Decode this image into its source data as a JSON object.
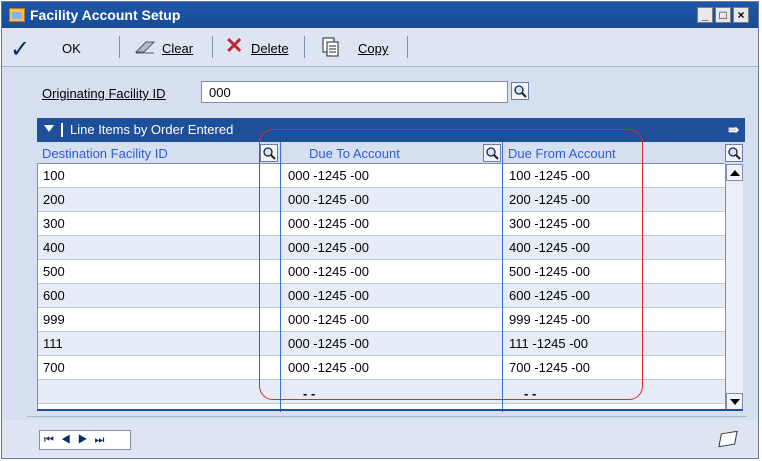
{
  "window": {
    "title": "Facility Account Setup"
  },
  "toolbar": {
    "ok": "OK",
    "clear": "Clear",
    "delete": "Delete",
    "copy": "Copy"
  },
  "form": {
    "originating_label": "Originating Facility ID",
    "originating_value": "000"
  },
  "grid": {
    "header": "Line Items by Order Entered",
    "columns": [
      "Destination Facility ID",
      "Due To Account",
      "Due From Account"
    ],
    "rows": [
      [
        "100",
        "000 -1245 -00",
        "100 -1245 -00"
      ],
      [
        "200",
        "000 -1245 -00",
        "200 -1245 -00"
      ],
      [
        "300",
        "000 -1245 -00",
        "300 -1245 -00"
      ],
      [
        "400",
        "000 -1245 -00",
        "400 -1245 -00"
      ],
      [
        "500",
        "000 -1245 -00",
        "500 -1245 -00"
      ],
      [
        "600",
        "000 -1245 -00",
        "600 -1245 -00"
      ],
      [
        "999",
        "000 -1245 -00",
        "999 -1245 -00"
      ],
      [
        "111",
        "000 -1245 -00",
        "111 -1245 -00"
      ],
      [
        "700",
        "000 -1245 -00",
        "700 -1245 -00"
      ]
    ],
    "empty_row": [
      "",
      "-   -",
      "-   -"
    ]
  },
  "status": {
    "nav_icons": "navigation-first-prev-next-last"
  },
  "colors": {
    "title_bar": "#1f57a8",
    "grid_header": "#1e4f99",
    "highlight": "#e0262d"
  }
}
